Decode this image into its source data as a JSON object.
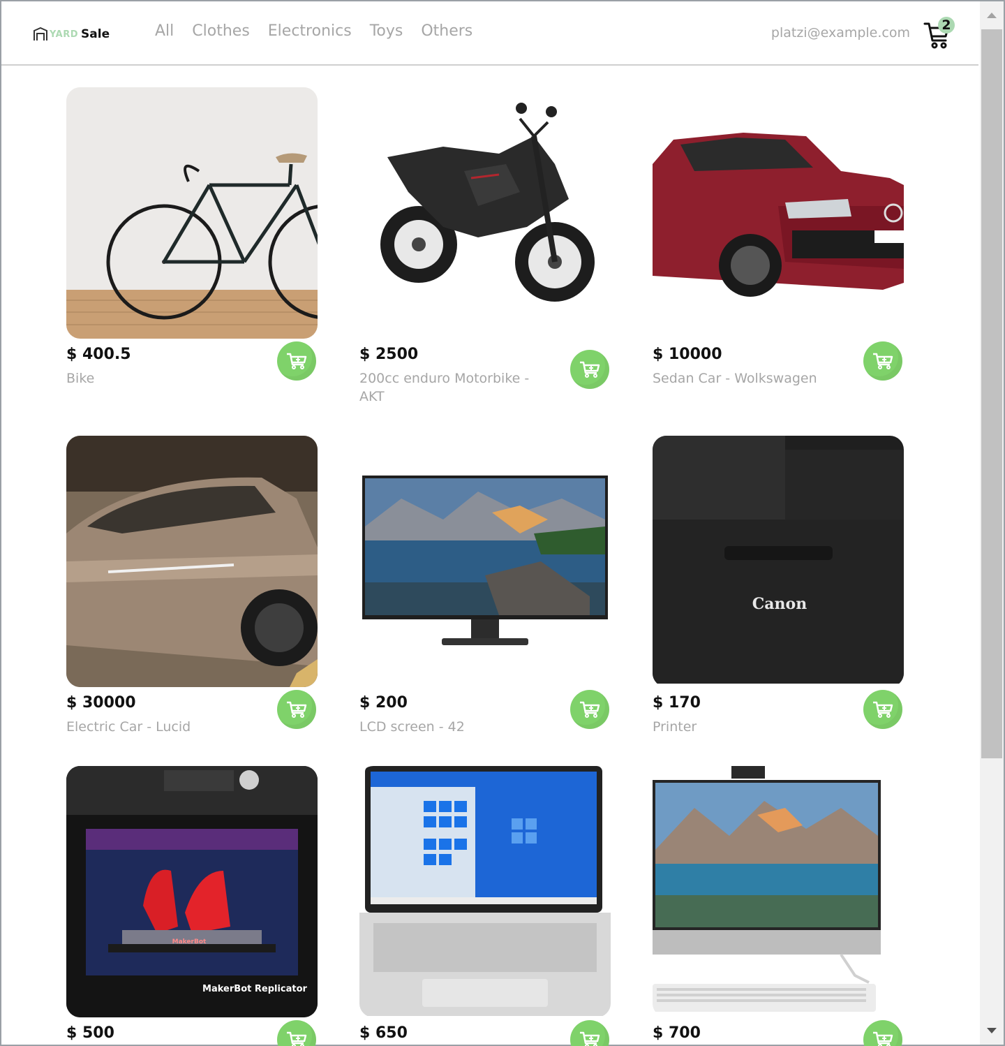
{
  "brand": {
    "yard": "YARD",
    "sale": "Sale"
  },
  "nav": {
    "categories": [
      "All",
      "Clothes",
      "Electronics",
      "Toys",
      "Others"
    ],
    "email": "platzi@example.com",
    "cart_count": "2"
  },
  "colors": {
    "accent_green": "#7fd26a",
    "badge_green": "#acd9b2",
    "muted_text": "#a6a6a6"
  },
  "products": [
    {
      "price": "$ 400.5",
      "name": "Bike",
      "image": "bicycle"
    },
    {
      "price": "$ 2500",
      "name": "200cc enduro Motorbike - AKT",
      "image": "motorbike"
    },
    {
      "price": "$ 10000",
      "name": "Sedan Car - Wolkswagen",
      "image": "red-sedan"
    },
    {
      "price": "$ 30000",
      "name": "Electric Car - Lucid",
      "image": "electric-car"
    },
    {
      "price": "$ 200",
      "name": "LCD screen - 42",
      "image": "monitor"
    },
    {
      "price": "$ 170",
      "name": "Printer",
      "image": "printer",
      "brand_label": "Canon"
    },
    {
      "price": "$ 500",
      "name": "",
      "image": "3d-printer",
      "brand_label": "MakerBot Replicator",
      "plate_label": "MakerBot"
    },
    {
      "price": "$ 650",
      "name": "",
      "image": "laptop"
    },
    {
      "price": "$ 700",
      "name": "",
      "image": "all-in-one"
    }
  ]
}
